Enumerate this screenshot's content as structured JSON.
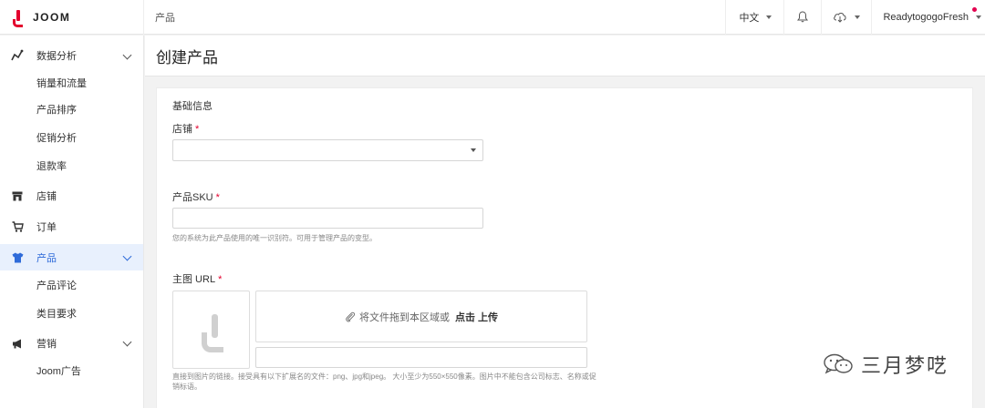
{
  "topbar": {
    "brand": "JOOM",
    "breadcrumb": "产品",
    "language": "中文",
    "username": "ReadytogogoFresh"
  },
  "sidebar": {
    "sections": [
      {
        "label": "数据分析",
        "icon": "analytics-icon",
        "expanded": true,
        "children": [
          "销量和流量",
          "产品排序",
          "促销分析",
          "退款率"
        ]
      },
      {
        "label": "店铺",
        "icon": "store-icon"
      },
      {
        "label": "订单",
        "icon": "cart-icon"
      },
      {
        "label": "产品",
        "icon": "shirt-icon",
        "active": true,
        "expanded": true,
        "children": [
          "产品评论",
          "类目要求"
        ]
      },
      {
        "label": "营销",
        "icon": "megaphone-icon",
        "expanded": true,
        "children": [
          "Joom广告"
        ]
      }
    ]
  },
  "page": {
    "title": "创建产品",
    "section_title": "基础信息",
    "store_label": "店铺",
    "store_value": "",
    "sku_label": "产品SKU",
    "sku_value": "",
    "sku_hint": "您的系统为此产品使用的唯一识别符。可用于管理产品的变型。",
    "main_image_label": "主图 URL",
    "required_mark": "*",
    "dropzone_text": "将文件拖到本区域或",
    "dropzone_action": "点击 上传",
    "main_image_url": "",
    "image_hint": "直接到图片的链接。接受具有以下扩展名的文件：png、jpg和jpeg。 大小至少为550×550像素。图片中不能包含公司标志、名称或促销标语。"
  },
  "watermark": {
    "text": "三月梦呓"
  },
  "colors": {
    "brand_red": "#e3002d",
    "active_blue": "#2f6bd9",
    "active_bg": "#e8f0fd"
  }
}
